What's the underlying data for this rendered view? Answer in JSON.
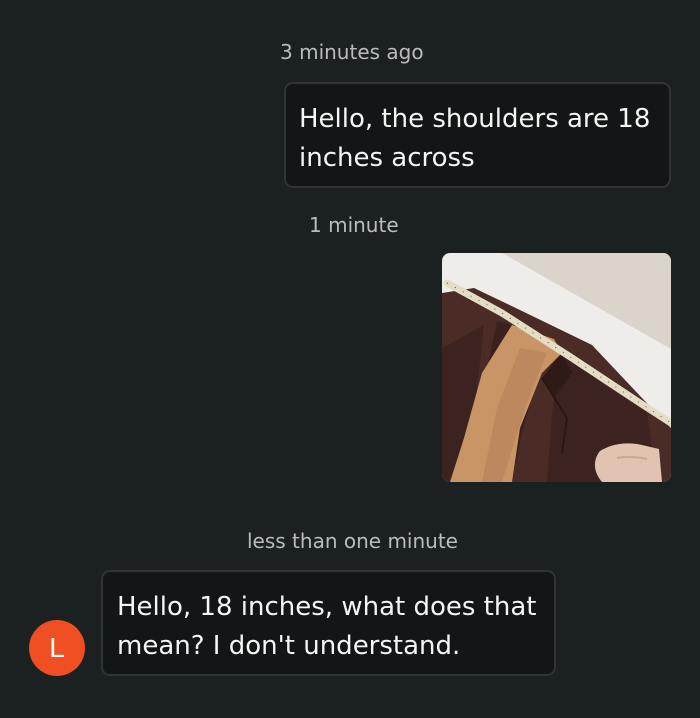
{
  "messages": [
    {
      "timestamp": "3 minutes ago",
      "sender": "me",
      "text": "Hello, the shoulders are 18 inches across"
    },
    {
      "timestamp": "1 minute",
      "sender": "me",
      "attachment": "jacket-shoulder-measurement-photo"
    },
    {
      "timestamp": "less than one minute",
      "sender": "other",
      "avatar_initial": "L",
      "text": "Hello, 18 inches, what does that mean? I don't understand."
    }
  ],
  "colors": {
    "background": "#1b2020",
    "bubble_fill": "#131616",
    "bubble_border": "#2f3535",
    "timestamp_text": "#b9bdbd",
    "avatar": "#f04e23"
  }
}
